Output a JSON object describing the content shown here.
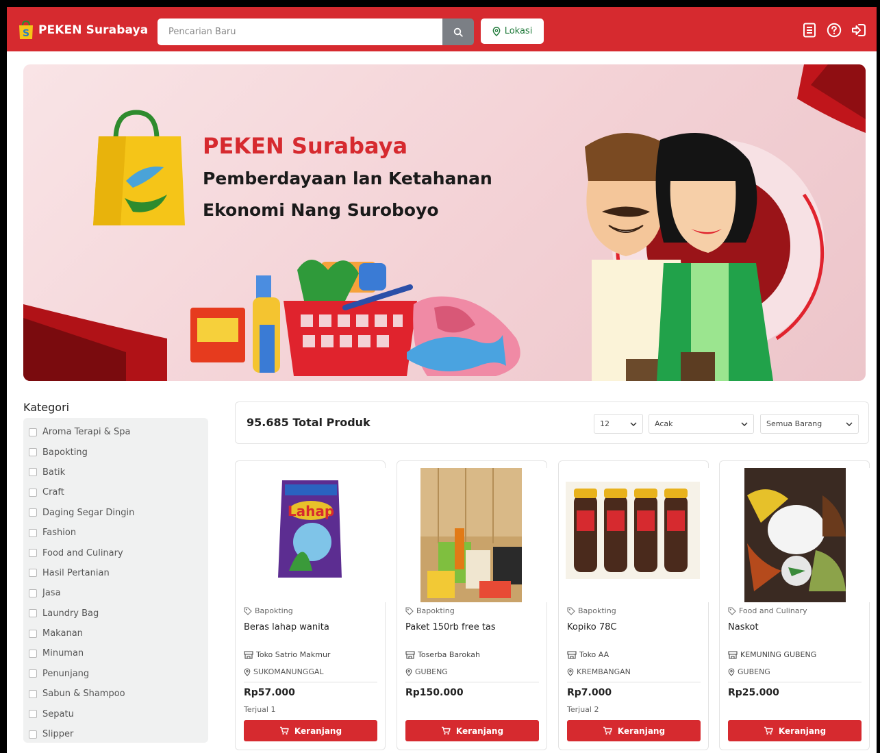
{
  "header": {
    "brand": "PEKEN Surabaya",
    "search_placeholder": "Pencarian Baru",
    "location_label": "Lokasi",
    "icons": [
      "document-icon",
      "help-icon",
      "logout-icon"
    ]
  },
  "banner": {
    "title": "PEKEN Surabaya",
    "line1": "Pemberdayaan lan Ketahanan",
    "line2": "Ekonomi Nang Suroboyo"
  },
  "sidebar": {
    "title": "Kategori",
    "items": [
      "Aroma Terapi & Spa",
      "Bapokting",
      "Batik",
      "Craft",
      "Daging Segar Dingin",
      "Fashion",
      "Food and Culinary",
      "Hasil Pertanian",
      "Jasa",
      "Laundry Bag",
      "Makanan",
      "Minuman",
      "Penunjang",
      "Sabun & Shampoo",
      "Sepatu",
      "Slipper"
    ]
  },
  "toolbar": {
    "total": "95.685 Total Produk",
    "per_page": "12",
    "sort": "Acak",
    "filter": "Semua Barang"
  },
  "products": [
    {
      "category": "Bapokting",
      "name": "Beras lahap wanita",
      "store": "Toko Satrio Makmur",
      "location": "SUKOMANUNGGAL",
      "price": "Rp57.000",
      "sold": "Terjual 1",
      "cart": "Keranjang"
    },
    {
      "category": "Bapokting",
      "name": "Paket 150rb free tas",
      "store": "Toserba Barokah",
      "location": "GUBENG",
      "price": "Rp150.000",
      "sold": "",
      "cart": "Keranjang"
    },
    {
      "category": "Bapokting",
      "name": "Kopiko 78C",
      "store": "Toko AA",
      "location": "KREMBANGAN",
      "price": "Rp7.000",
      "sold": "Terjual 2",
      "cart": "Keranjang"
    },
    {
      "category": "Food and Culinary",
      "name": "Naskot",
      "store": "KEMUNING GUBENG",
      "location": "GUBENG",
      "price": "Rp25.000",
      "sold": "",
      "cart": "Keranjang"
    }
  ],
  "colors": {
    "accent": "#d62a2f",
    "location_green": "#1f7a3a"
  }
}
